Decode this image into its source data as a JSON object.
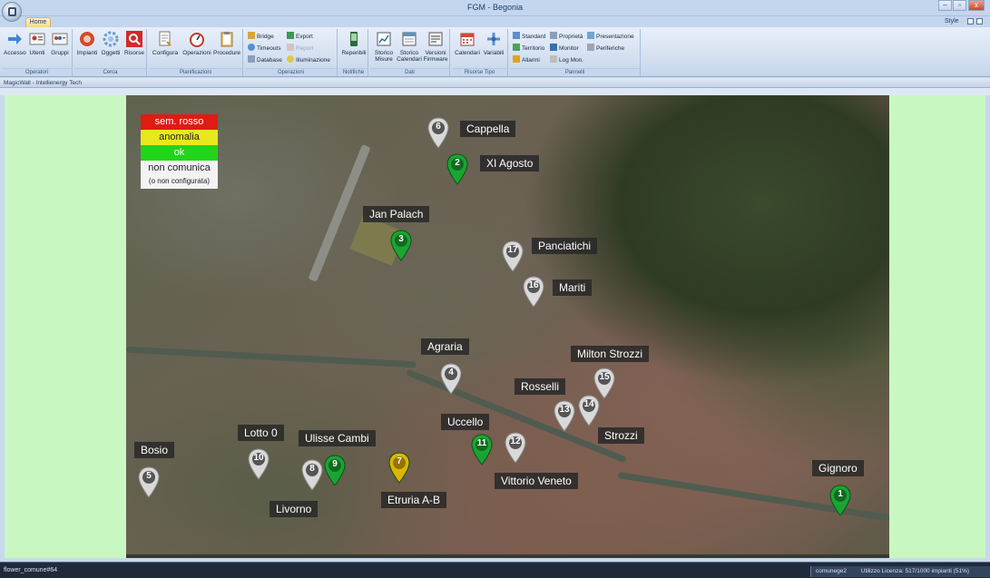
{
  "window": {
    "title": "FGM - Begonia",
    "minimize_glyph": "‒",
    "restore_glyph": "▫",
    "close_glyph": "x"
  },
  "tabs": {
    "home": "Home",
    "style": "Style"
  },
  "ribbon": {
    "operatori": {
      "label": "Operatori",
      "buttons": [
        {
          "label": "Accesso",
          "icon": "arrow-right-icon"
        },
        {
          "label": "Utenti",
          "icon": "user-card-icon"
        },
        {
          "label": "Gruppi",
          "icon": "group-card-icon"
        }
      ]
    },
    "cerca": {
      "label": "Cerca",
      "buttons": [
        {
          "label": "Impianti",
          "icon": "plant-icon"
        },
        {
          "label": "Oggetti",
          "icon": "gear-icon"
        },
        {
          "label": "Risorse",
          "icon": "search-icon"
        }
      ]
    },
    "pianificazioni": {
      "label": "Pianificazioni",
      "buttons": [
        {
          "label": "Configura",
          "icon": "configure-icon"
        },
        {
          "label": "Operazioni",
          "icon": "gauge-icon"
        },
        {
          "label": "Procedure",
          "icon": "clipboard-icon"
        }
      ]
    },
    "operazioni": {
      "label": "Operazioni",
      "items": [
        {
          "label": "Bridge"
        },
        {
          "label": "Timeouts"
        },
        {
          "label": "Database"
        },
        {
          "label": "Export"
        },
        {
          "label": "Report"
        },
        {
          "label": "Illuminazione"
        }
      ]
    },
    "notifiche": {
      "label": "Notifiche",
      "buttons": [
        {
          "label": "Reperibili",
          "icon": "phone-icon"
        }
      ]
    },
    "dati": {
      "label": "Dati",
      "buttons": [
        {
          "label": "Storico",
          "label2": "Misure",
          "icon": "history-icon"
        },
        {
          "label": "Storico",
          "label2": "Calendari",
          "icon": "calendar-list-icon"
        },
        {
          "label": "Versioni",
          "label2": "Firmware",
          "icon": "firmware-icon"
        }
      ]
    },
    "risorse_tipo": {
      "label": "Risorse Tipo",
      "buttons": [
        {
          "label": "Calendari",
          "icon": "calendar-icon"
        },
        {
          "label": "Variabili",
          "icon": "variables-icon"
        }
      ]
    },
    "pannelli": {
      "label": "Pannelli",
      "items": [
        {
          "label": "Standard"
        },
        {
          "label": "Territorio"
        },
        {
          "label": "Allarmi"
        },
        {
          "label": "Proprietà"
        },
        {
          "label": "Monitor"
        },
        {
          "label": "Log Mon."
        },
        {
          "label": "Presentazione"
        },
        {
          "label": "Periferiche"
        }
      ]
    }
  },
  "workspace": {
    "caption": "MagicWall - Intellienergy Tech"
  },
  "legend": {
    "items": [
      {
        "label": "sem. rosso",
        "color": "#e01b14"
      },
      {
        "label": "anomalia",
        "color": "#e8e81c"
      },
      {
        "label": "ok",
        "color": "#22d41c"
      },
      {
        "label": "non comunica",
        "color": "#f3f3f3"
      }
    ],
    "note": "(o non configurata)"
  },
  "markers": [
    {
      "id": "6",
      "name": "Cappella",
      "status": "grey"
    },
    {
      "id": "2",
      "name": "XI Agosto",
      "status": "green"
    },
    {
      "id": "3",
      "name": "Jan Palach",
      "status": "green"
    },
    {
      "id": "17",
      "name": "Panciatichi",
      "status": "grey"
    },
    {
      "id": "16",
      "name": "Mariti",
      "status": "grey"
    },
    {
      "id": "4",
      "name": "Agraria",
      "status": "grey"
    },
    {
      "id": "15",
      "name": "Milton Strozzi",
      "status": "grey"
    },
    {
      "id": "14",
      "name": "Rosselli",
      "status": "grey"
    },
    {
      "id": "13",
      "name": "Strozzi",
      "status": "grey"
    },
    {
      "id": "11",
      "name": "Uccello",
      "status": "green"
    },
    {
      "id": "12",
      "name": "Vittorio Veneto",
      "status": "grey"
    },
    {
      "id": "10",
      "name": "Lotto 0",
      "status": "grey"
    },
    {
      "id": "9",
      "name": "Ulisse Cambi",
      "status": "green"
    },
    {
      "id": "8",
      "name": "Livorno",
      "status": "grey"
    },
    {
      "id": "7",
      "name": "Etruria A-B",
      "status": "yellow"
    },
    {
      "id": "5",
      "name": "Bosio",
      "status": "grey"
    },
    {
      "id": "1",
      "name": "Gignoro",
      "status": "green"
    }
  ],
  "status_colors": {
    "grey": "#d9d9d9",
    "green": "#1aa532",
    "yellow": "#e0b400"
  },
  "statusbar": {
    "left": "flower_comune#64",
    "user": "comunege2",
    "license": "Utilizzo Licenza: 517/1000 impianti (51%)"
  }
}
